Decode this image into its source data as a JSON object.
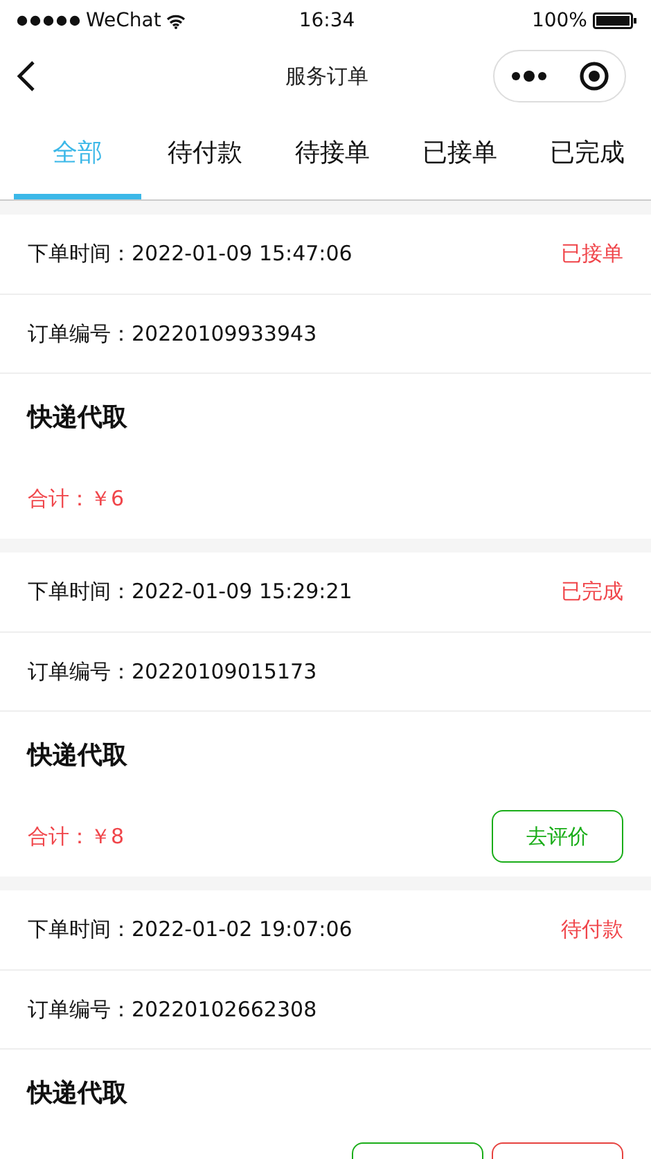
{
  "status_bar": {
    "carrier": "WeChat",
    "time": "16:34",
    "battery": "100%"
  },
  "nav": {
    "title": "服务订单"
  },
  "tabs": [
    {
      "label": "全部",
      "selected": true
    },
    {
      "label": "待付款",
      "selected": false
    },
    {
      "label": "待接单",
      "selected": false
    },
    {
      "label": "已接单",
      "selected": false
    },
    {
      "label": "已完成",
      "selected": false
    }
  ],
  "orders": [
    {
      "time_label": "下单时间：",
      "time": "2022-01-09 15:47:06",
      "status": "已接单",
      "number_label": "订单编号：",
      "number": "20220109933943",
      "title": "快递代取",
      "total": "合计：￥6"
    },
    {
      "time_label": "下单时间：",
      "time": "2022-01-09 15:29:21",
      "status": "已完成",
      "number_label": "订单编号：",
      "number": "20220109015173",
      "title": "快递代取",
      "total": "合计：￥8",
      "buttons": [
        {
          "label": "去评价",
          "color": "#1aad19"
        }
      ]
    },
    {
      "time_label": "下单时间：",
      "time": "2022-01-02 19:07:06",
      "status": "待付款",
      "number_label": "订单编号：",
      "number": "20220102662308",
      "title": "快递代取",
      "buttons": [
        {
          "color": "#1aad19"
        },
        {
          "color": "#e64340"
        }
      ]
    }
  ]
}
